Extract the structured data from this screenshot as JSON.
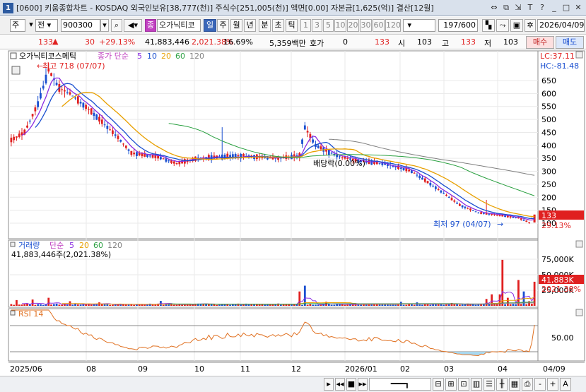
{
  "window": {
    "badge": "1",
    "title": "[0600] 키움종합차트 - KOSDAQ 외국인보유[38,777(천)] 주식수[251,005(천)] 액면[0.00] 자본금[1,625(억)] 결산[12월]"
  },
  "toolbar": {
    "period_unit": "주",
    "market": "전",
    "code": "900300",
    "stock_name": "오가닉티코",
    "mode_day": "일",
    "mode_week": "주",
    "mode_month": "월",
    "mode_year": "년",
    "mode_min": "분",
    "mode_sec": "초",
    "mode_tick": "틱",
    "intervals": [
      "1",
      "3",
      "5",
      "10",
      "20",
      "30",
      "60",
      "120"
    ],
    "page_count": "197/600",
    "date": "2026/04/09"
  },
  "quote": {
    "price": "133",
    "change": "30",
    "change_pct": "+29.13%",
    "volume": "41,883,446",
    "volume_pct": "2,021.38%",
    "turnover": "16.69%",
    "amount": "5,359백만",
    "bid_label": "호가",
    "bid_value": "0",
    "bid_price": "133",
    "open_label": "시",
    "open": "103",
    "high_label": "고",
    "high": "133",
    "low_label": "저",
    "low": "103",
    "buy_label": "매수",
    "sell_label": "매도"
  },
  "price_panel": {
    "legend_name": "오가닉티코스메틱",
    "ma_label": "종가 단순",
    "ma_periods": [
      "5",
      "10",
      "20",
      "60",
      "120"
    ],
    "lc": "LC:37.11",
    "hc": "HC:-81.48",
    "high_note": "최고 718 (07/07)",
    "low_note": "최저 97 (04/07)",
    "event_note": "배당락(0.00%)",
    "last_price_tag": "133",
    "last_pct_tag": "29.13%",
    "y_ticks": [
      "650",
      "600",
      "550",
      "500",
      "450",
      "400",
      "350",
      "300",
      "250",
      "200",
      "150",
      "100"
    ]
  },
  "volume_panel": {
    "label": "거래량",
    "ma_label": "단순",
    "ma_periods": [
      "5",
      "20",
      "60",
      "120"
    ],
    "summary": "41,883,446주(2,021.38%)",
    "y_ticks": [
      "75,000K",
      "50,000K",
      "25,000K"
    ],
    "last_tag": "41,883K",
    "last_pct": "2021.38%"
  },
  "rsi_panel": {
    "label": "RSI 14",
    "y_tick": "50.00"
  },
  "x_axis": [
    "2025/06",
    "08",
    "09",
    "10",
    "11",
    "12",
    "2026/01",
    "02",
    "03",
    "04",
    "04/09"
  ],
  "colors": {
    "up": "#e02020",
    "down": "#1a4fd0",
    "ma5": "#8a2be2",
    "ma10": "#1a4fd0",
    "ma20": "#e8a000",
    "ma60": "#2aa040",
    "ma120": "#808080",
    "rsi": "#e07020"
  }
}
